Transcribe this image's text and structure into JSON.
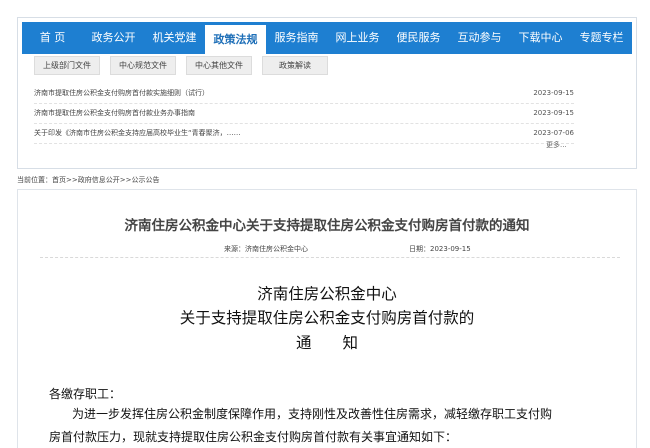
{
  "nav": {
    "items": [
      {
        "label": "首 页"
      },
      {
        "label": "政务公开"
      },
      {
        "label": "机关党建"
      },
      {
        "label": "政策法规",
        "active": true
      },
      {
        "label": "服务指南"
      },
      {
        "label": "网上业务"
      },
      {
        "label": "便民服务"
      },
      {
        "label": "互动参与"
      },
      {
        "label": "下载中心"
      },
      {
        "label": "专题专栏"
      }
    ],
    "colors": {
      "bar": "#1e7fd1",
      "active_text": "#1e6fb8"
    }
  },
  "subtabs": [
    "上级部门文件",
    "中心规范文件",
    "中心其他文件",
    "政策解读"
  ],
  "list": [
    {
      "title": "济南市提取住房公积金支付购房首付款实施细则（试行）",
      "date": "2023-09-15"
    },
    {
      "title": "济南市提取住房公积金支付购房首付款业务办事指南",
      "date": "2023-09-15"
    },
    {
      "title": "关于印发《济南市住房公积金支持应届高校毕业生“青春聚济，……",
      "date": "2023-07-06"
    }
  ],
  "more": "更多...",
  "breadcrumb": "当前位置：首页>>政府信息公开>>公示公告",
  "article": {
    "title": "济南住房公积金中心关于支持提取住房公积金支付购房首付款的通知",
    "source": "来源：济南住房公积金中心",
    "date": "日期：2023-09-15",
    "doc_org": "济南住房公积金中心",
    "doc_subject": "关于支持提取住房公积金支付购房首付款的",
    "doc_kind": "通　　知",
    "salutation": "各缴存职工：",
    "para_line1": "为进一步发挥住房公积金制度保障作用，支持刚性及改善性住房需求，减轻缴存职工支付购",
    "para_line2": "房首付款压力，现就支持提取住房公积金支付购房首付款有关事宜通知如下："
  }
}
